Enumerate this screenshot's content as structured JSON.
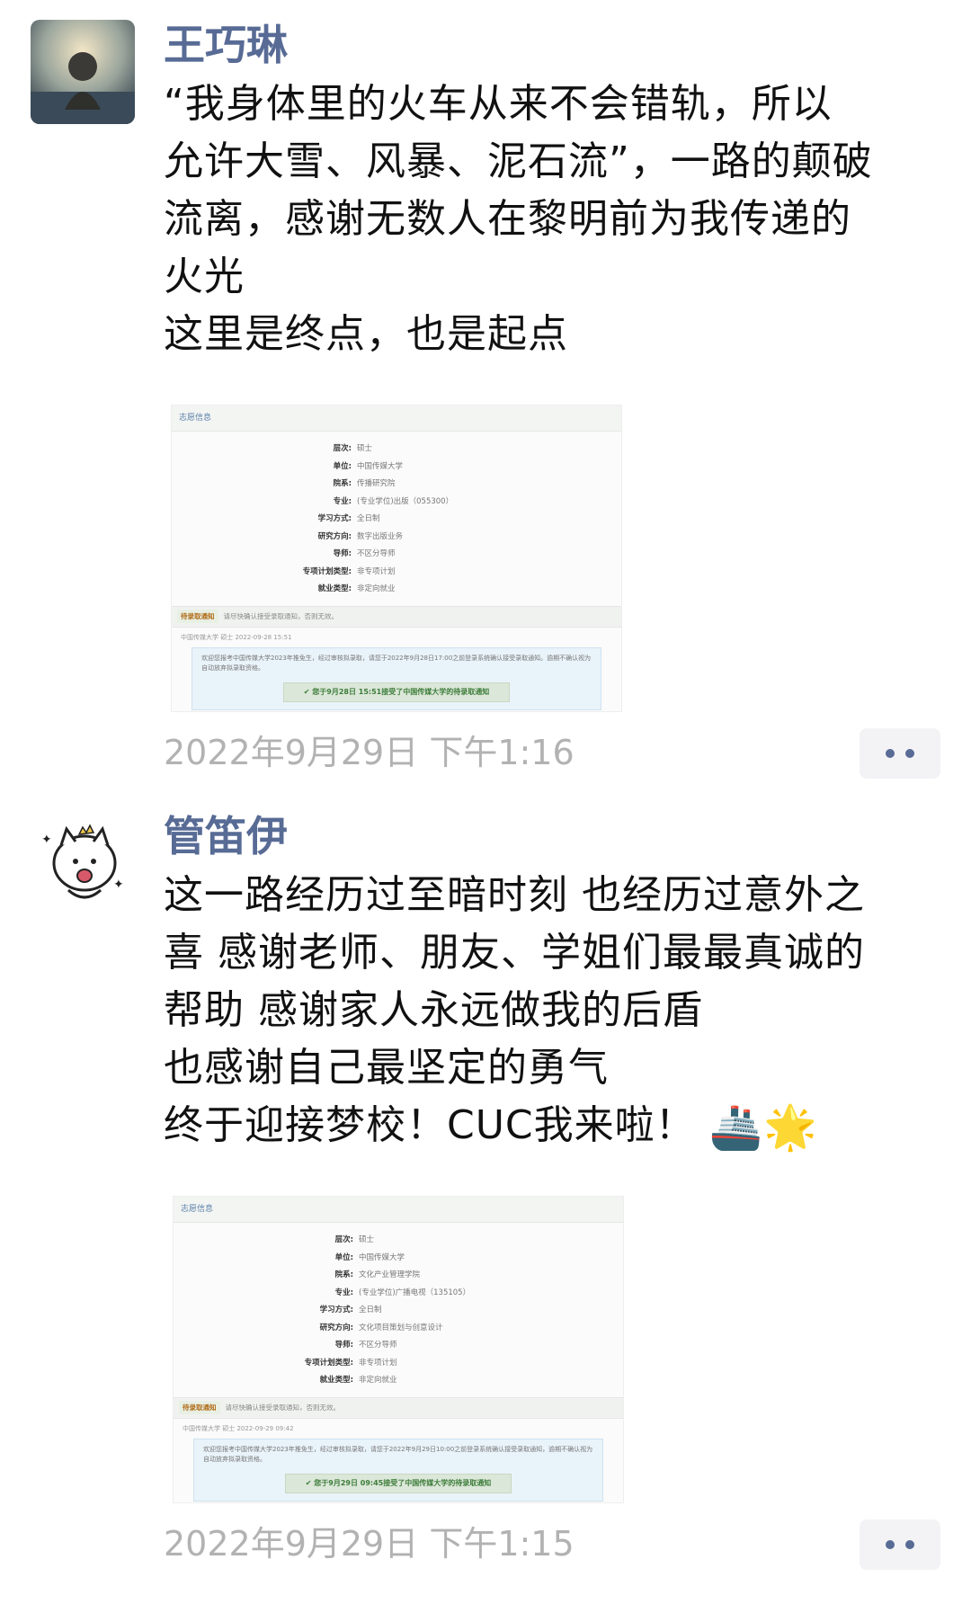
{
  "posts": [
    {
      "author": "王巧琳",
      "text": "“我身体里的火车从来不会错轨，所以\n允许大雪、风暴、泥石流”，一路的颠破\n流离，感谢无数人在黎明前为我传递的\n火光\n这里是终点，也是起点",
      "timestamp": "2022年9月29日 下午1:16",
      "card": {
        "header": "志愿信息",
        "rows": [
          {
            "k": "层次:",
            "v": "硕士"
          },
          {
            "k": "单位:",
            "v": "中国传媒大学"
          },
          {
            "k": "院系:",
            "v": "传播研究院"
          },
          {
            "k": "专业:",
            "v": "(专业学位)出版（055300）"
          },
          {
            "k": "学习方式:",
            "v": "全日制"
          },
          {
            "k": "研究方向:",
            "v": "数字出版业务"
          },
          {
            "k": "导师:",
            "v": "不区分导师"
          },
          {
            "k": "专项计划类型:",
            "v": "非专项计划"
          },
          {
            "k": "就业类型:",
            "v": "非定向就业"
          }
        ],
        "notice_tag": "待录取通知",
        "notice_text": "请尽快确认接受录取通知，否则无效。",
        "meta": "中国传媒大学 硕士 2022-09-28 15:51",
        "para": "欢迎您报考中国传媒大学2023年推免生，经过审核拟录取，请您于2022年9月28日17:00之前登录系统确认接受录取通知。逾期不确认视为自动放弃拟录取资格。",
        "accept": "您于9月28日 15:51接受了中国传媒大学的待录取通知"
      }
    },
    {
      "author": "管笛伊",
      "text": "这一路经历过至暗时刻 也经历过意外之\n喜 感谢老师、朋友、学姐们最最真诚的\n帮助 感谢家人永远做我的后盾\n也感谢自己最坚定的勇气\n终于迎接梦校！CUC我来啦！",
      "emojis": [
        "🚢",
        "🌟"
      ],
      "timestamp": "2022年9月29日 下午1:15",
      "card": {
        "header": "志愿信息",
        "rows": [
          {
            "k": "层次:",
            "v": "硕士"
          },
          {
            "k": "单位:",
            "v": "中国传媒大学"
          },
          {
            "k": "院系:",
            "v": "文化产业管理学院"
          },
          {
            "k": "专业:",
            "v": "(专业学位)广播电视（135105）"
          },
          {
            "k": "学习方式:",
            "v": "全日制"
          },
          {
            "k": "研究方向:",
            "v": "文化项目策划与创意设计"
          },
          {
            "k": "导师:",
            "v": "不区分导师"
          },
          {
            "k": "专项计划类型:",
            "v": "非专项计划"
          },
          {
            "k": "就业类型:",
            "v": "非定向就业"
          }
        ],
        "notice_tag": "待录取通知",
        "notice_text": "请尽快确认接受录取通知，否则无效。",
        "meta": "中国传媒大学 硕士 2022-09-29 09:42",
        "para": "欢迎您报考中国传媒大学2023年推免生，经过审核拟录取，请您于2022年9月29日10:00之前登录系统确认接受录取通知，逾期不确认视为自动放弃拟录取资格。",
        "accept": "您于9月29日 09:45接受了中国传媒大学的待录取通知"
      }
    }
  ],
  "colors": {
    "name": "#576b95",
    "timestamp": "#b2b2b2",
    "accept": "#3d7d3a"
  }
}
